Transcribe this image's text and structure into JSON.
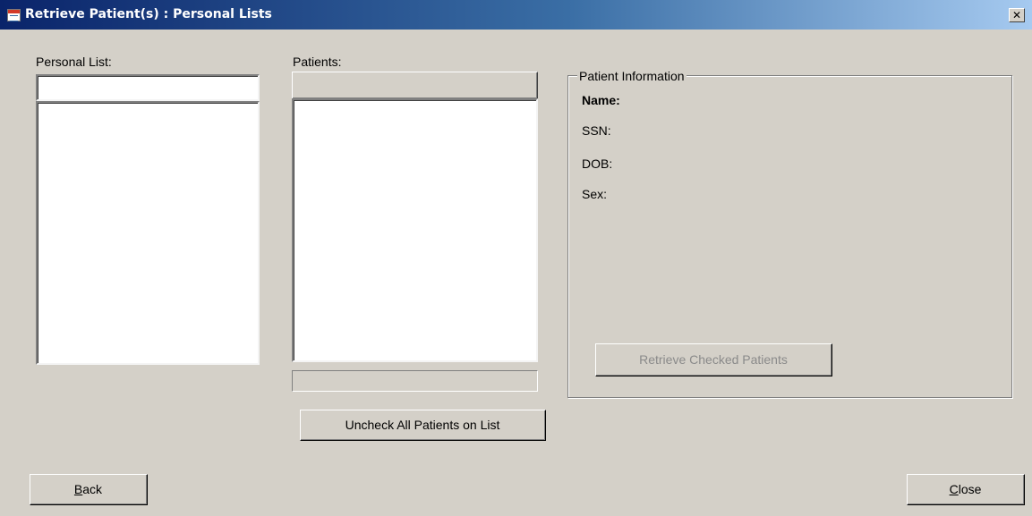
{
  "window": {
    "title": "Retrieve Patient(s) : Personal Lists",
    "close_glyph": "✕"
  },
  "personal_list": {
    "label": "Personal List:",
    "input_value": "",
    "items": []
  },
  "patients": {
    "label": "Patients:",
    "header_text": "",
    "items": [],
    "status_text": ""
  },
  "patient_info": {
    "group_title": "Patient Information",
    "name_label": "Name:",
    "ssn_label": "SSN:",
    "dob_label": "DOB:",
    "sex_label": "Sex:",
    "retrieve_button": "Retrieve Checked Patients",
    "retrieve_enabled": false
  },
  "buttons": {
    "uncheck_all": "Uncheck All Patients on List",
    "back_first": "B",
    "back_rest": "ack",
    "close_first": "C",
    "close_rest": "lose"
  },
  "colors": {
    "face": "#d4d0c8",
    "titlebar_start": "#0a246a",
    "titlebar_end": "#a6caf0",
    "disabled_text": "#8a8a8a"
  }
}
